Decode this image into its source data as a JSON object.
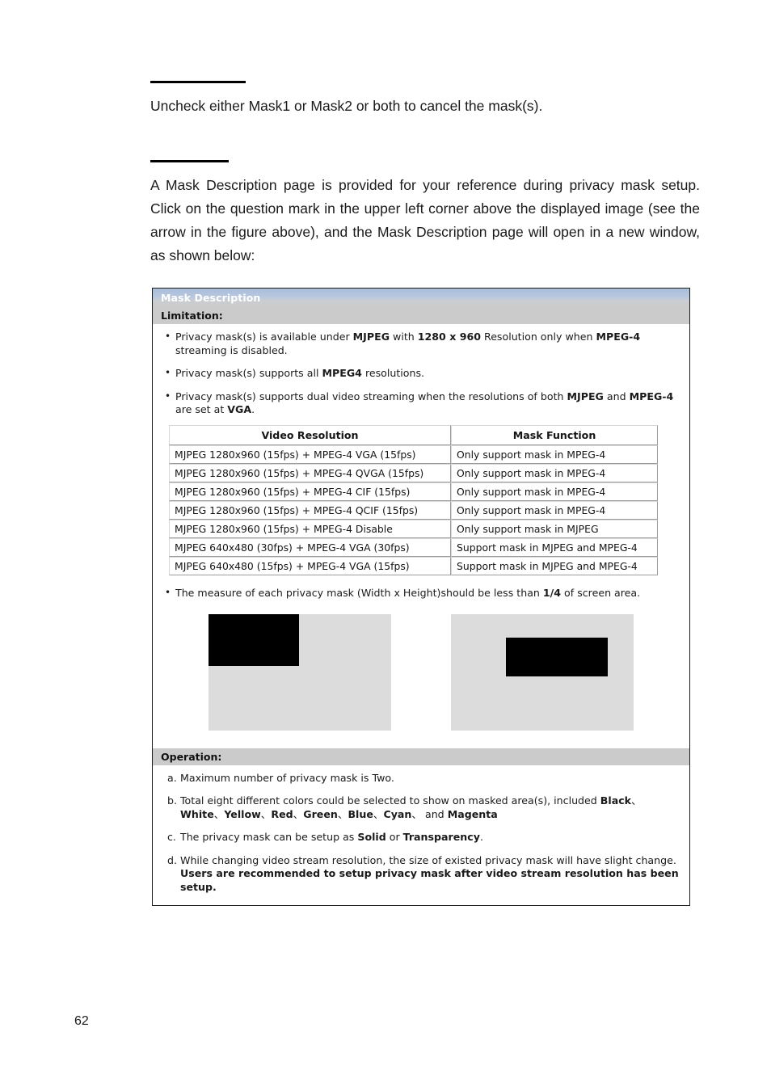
{
  "document": {
    "page_number": "62",
    "paragraphs": [
      {
        "id": "p1",
        "text": "Uncheck either Mask1 or Mask2 or both to cancel the mask(s)."
      },
      {
        "id": "p2",
        "text": "A Mask Description page is provided for your reference during privacy mask setup. Click on the question mark in the upper left corner above the displayed image (see the arrow in the figure above), and the Mask Description page will open in a new window, as shown below:"
      }
    ]
  },
  "mask_panel": {
    "title": "Mask Description",
    "colors": {
      "titlebar_accent": "#a9bcd9",
      "section_band": "#cbcbcb",
      "mask_fill": "#000000",
      "image_placeholder": "#dcdcdc",
      "panel_border": "#1c1c1c"
    },
    "limitation": {
      "heading": "Limitation:",
      "bullets": [
        {
          "parts": [
            {
              "t": "Privacy mask(s) is available under ",
              "b": false
            },
            {
              "t": "MJPEG",
              "b": true
            },
            {
              "t": " with ",
              "b": false
            },
            {
              "t": "1280 x 960",
              "b": true
            },
            {
              "t": " Resolution only when ",
              "b": false
            },
            {
              "t": "MPEG-4",
              "b": true
            },
            {
              "t": " streaming is disabled.",
              "b": false
            }
          ]
        },
        {
          "parts": [
            {
              "t": "Privacy mask(s) supports all ",
              "b": false
            },
            {
              "t": "MPEG4",
              "b": true
            },
            {
              "t": " resolutions.",
              "b": false
            }
          ]
        },
        {
          "parts": [
            {
              "t": "Privacy mask(s) supports dual video streaming when the resolutions of both ",
              "b": false
            },
            {
              "t": "MJPEG",
              "b": true
            },
            {
              "t": " and ",
              "b": false
            },
            {
              "t": "MPEG-4",
              "b": true
            },
            {
              "t": " are set at ",
              "b": false
            },
            {
              "t": "VGA",
              "b": true
            },
            {
              "t": ".",
              "b": false
            }
          ]
        }
      ]
    },
    "table": {
      "headers": [
        "Video Resolution",
        "Mask Function"
      ],
      "rows": [
        [
          "MJPEG 1280x960 (15fps) + MPEG-4 VGA (15fps)",
          "Only support mask in MPEG-4"
        ],
        [
          "MJPEG 1280x960 (15fps) + MPEG-4 QVGA (15fps)",
          "Only support mask in MPEG-4"
        ],
        [
          "MJPEG 1280x960 (15fps) + MPEG-4 CIF (15fps)",
          "Only support mask in MPEG-4"
        ],
        [
          "MJPEG 1280x960 (15fps) + MPEG-4 QCIF (15fps)",
          "Only support mask in MPEG-4"
        ],
        [
          "MJPEG 1280x960 (15fps) + MPEG-4 Disable",
          "Only support mask in MJPEG"
        ],
        [
          "MJPEG 640x480 (30fps) + MPEG-4 VGA (30fps)",
          "Support mask in MJPEG and MPEG-4"
        ],
        [
          "MJPEG 640x480 (15fps) + MPEG-4 VGA (15fps)",
          "Support mask in MJPEG and MPEG-4"
        ]
      ]
    },
    "measure_note": {
      "parts": [
        {
          "t": "The measure of each privacy mask (Width x Height)should be less than ",
          "b": false
        },
        {
          "t": "1/4",
          "b": true
        },
        {
          "t": " of screen area.",
          "b": false
        }
      ]
    },
    "examples": [
      {
        "name": "mask-example-corner"
      },
      {
        "name": "mask-example-center"
      }
    ],
    "operation": {
      "heading": "Operation:",
      "items": [
        {
          "marker": "a.",
          "parts": [
            {
              "t": "Maximum number of privacy mask is Two.",
              "b": false
            }
          ]
        },
        {
          "marker": "b.",
          "parts": [
            {
              "t": "Total eight different colors could be selected to show on masked area(s), included ",
              "b": false
            },
            {
              "t": "Black",
              "b": true
            },
            {
              "t": "、",
              "b": false
            },
            {
              "t": "White",
              "b": true
            },
            {
              "t": "、",
              "b": false
            },
            {
              "t": "Yellow",
              "b": true
            },
            {
              "t": "、",
              "b": false
            },
            {
              "t": "Red",
              "b": true
            },
            {
              "t": "、",
              "b": false
            },
            {
              "t": "Green",
              "b": true
            },
            {
              "t": "、",
              "b": false
            },
            {
              "t": "Blue",
              "b": true
            },
            {
              "t": "、",
              "b": false
            },
            {
              "t": "Cyan",
              "b": true
            },
            {
              "t": "、",
              "b": false
            },
            {
              "t": " and ",
              "b": false
            },
            {
              "t": "Magenta",
              "b": true
            }
          ]
        },
        {
          "marker": "c.",
          "parts": [
            {
              "t": "The privacy mask can be setup as ",
              "b": false
            },
            {
              "t": "Solid",
              "b": true
            },
            {
              "t": " or ",
              "b": false
            },
            {
              "t": "Transparency",
              "b": true
            },
            {
              "t": ".",
              "b": false
            }
          ]
        },
        {
          "marker": "d.",
          "parts": [
            {
              "t": "While changing video stream resolution, the size of existed privacy mask will have slight change. ",
              "b": false
            },
            {
              "t": "Users are recommended to setup privacy mask after video stream resolution has been setup.",
              "b": true
            }
          ]
        }
      ]
    }
  }
}
